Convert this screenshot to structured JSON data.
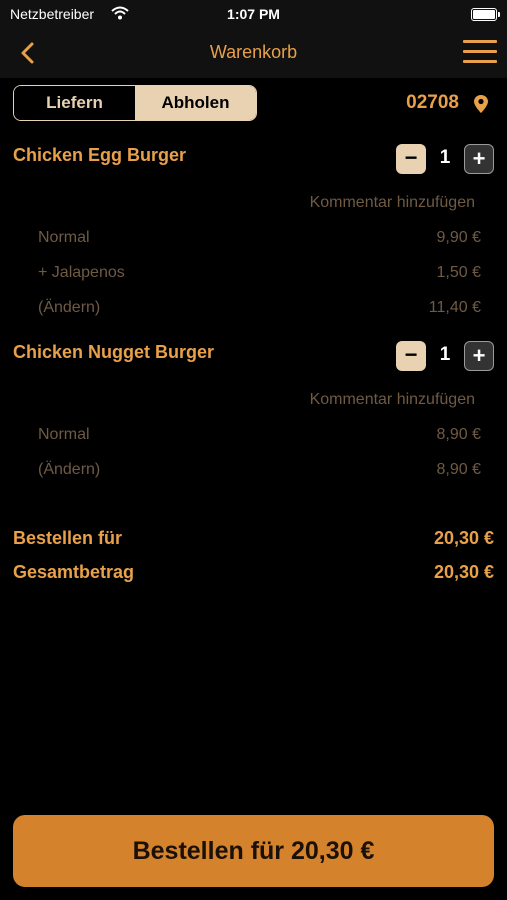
{
  "status_bar": {
    "carrier": "Netzbetreiber",
    "time": "1:07 PM"
  },
  "nav": {
    "title": "Warenkorb"
  },
  "segmented": {
    "delivery": "Liefern",
    "pickup": "Abholen",
    "selected": "Abholen"
  },
  "location": {
    "zip": "02708"
  },
  "cart": {
    "items": [
      {
        "name": "Chicken Egg Burger",
        "quantity": "1",
        "comment_label": "Kommentar hinzufügen",
        "lines": [
          {
            "label": "Normal",
            "price": "9,90 €"
          },
          {
            "label": "+ Jalapenos",
            "price": "1,50 €"
          },
          {
            "label": "(Ändern)",
            "price": "11,40 €"
          }
        ]
      },
      {
        "name": "Chicken Nugget Burger",
        "quantity": "1",
        "comment_label": "Kommentar hinzufügen",
        "lines": [
          {
            "label": "Normal",
            "price": "8,90 €"
          },
          {
            "label": "(Ändern)",
            "price": "8,90 €"
          }
        ]
      }
    ]
  },
  "summary": {
    "order_for_label": "Bestellen für",
    "order_for_value": "20,30 €",
    "total_label": "Gesamtbetrag",
    "total_value": "20,30 €"
  },
  "order_button": {
    "label": "Bestellen für 20,30 €"
  },
  "colors": {
    "accent": "#e8a04a",
    "segment_active": "#e8d2b2",
    "muted": "#6f5a44",
    "button": "#d4822c"
  }
}
